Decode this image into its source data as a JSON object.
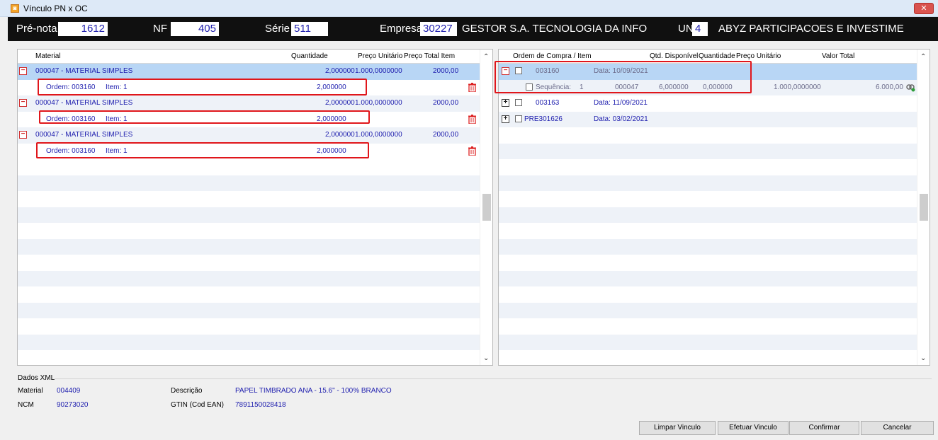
{
  "window": {
    "title": "Vínculo PN x OC",
    "close_glyph": "✕"
  },
  "header": {
    "pre_nota_label": "Pré-nota",
    "pre_nota_value": "1612",
    "nf_label": "NF",
    "nf_value": "405",
    "serie_label": "Série",
    "serie_value": "511",
    "empresa_label": "Empresa",
    "empresa_code": "30227",
    "empresa_name": "GESTOR S.A. TECNOLOGIA DA INFO",
    "un_label": "UN",
    "un_code": "4",
    "un_name": "ABYZ PARTICIPACOES E INVESTIME"
  },
  "left_grid": {
    "columns": [
      "Material",
      "Quantidade",
      "Preço Unitário",
      "Preço Total Item"
    ],
    "rows": [
      {
        "material": "000047 - MATERIAL SIMPLES",
        "quantidade": "2,000000",
        "preco_unitario": "1.000,0000000",
        "preco_total": "2000,00",
        "order": "Ordem: 003160",
        "item": "Item: 1",
        "order_qty": "2,000000"
      },
      {
        "material": "000047 - MATERIAL SIMPLES",
        "quantidade": "2,000000",
        "preco_unitario": "1.000,0000000",
        "preco_total": "2000,00",
        "order": "Ordem: 003160",
        "item": "Item: 1",
        "order_qty": "2,000000"
      },
      {
        "material": "000047 - MATERIAL SIMPLES",
        "quantidade": "2,000000",
        "preco_unitario": "1.000,0000000",
        "preco_total": "2000,00",
        "order": "Ordem: 003160",
        "item": "Item: 1",
        "order_qty": "2,000000"
      }
    ]
  },
  "right_grid": {
    "columns": [
      "Ordem de Compra / Item",
      "Qtd. Disponível",
      "Quantidade",
      "Preço Unitário",
      "Valor Total"
    ],
    "orders": [
      {
        "number": "003160",
        "date": "Data: 10/09/2021",
        "expanded": true
      },
      {
        "number": "003163",
        "date": "Data: 11/09/2021",
        "expanded": false
      },
      {
        "number": "PRE301626",
        "date": "Data: 03/02/2021",
        "expanded": false
      }
    ],
    "sequence": {
      "label": "Sequência:",
      "seq": "1",
      "material": "000047",
      "qtd_disponivel": "6,000000",
      "quantidade": "0,000000",
      "preco_unitario": "1.000,0000000",
      "valor_total": "6.000,00"
    }
  },
  "dados_xml": {
    "legend": "Dados XML",
    "material_label": "Material",
    "material_value": "004409",
    "descricao_label": "Descrição",
    "descricao_value": "PAPEL TIMBRADO ANA - 15.6\" - 100% BRANCO",
    "ncm_label": "NCM",
    "ncm_value": "90273020",
    "gtin_label": "GTIN (Cod EAN)",
    "gtin_value": "7891150028418"
  },
  "buttons": {
    "limpar": "Limpar Vinculo",
    "efetuar": "Efetuar Vinculo",
    "confirmar": "Confirmar",
    "cancelar": "Cancelar"
  },
  "colors": {
    "accent_blue": "#1e1eae",
    "highlight_red": "#e0161b",
    "selection": "#b8d6f5",
    "header_bg": "#101010"
  }
}
